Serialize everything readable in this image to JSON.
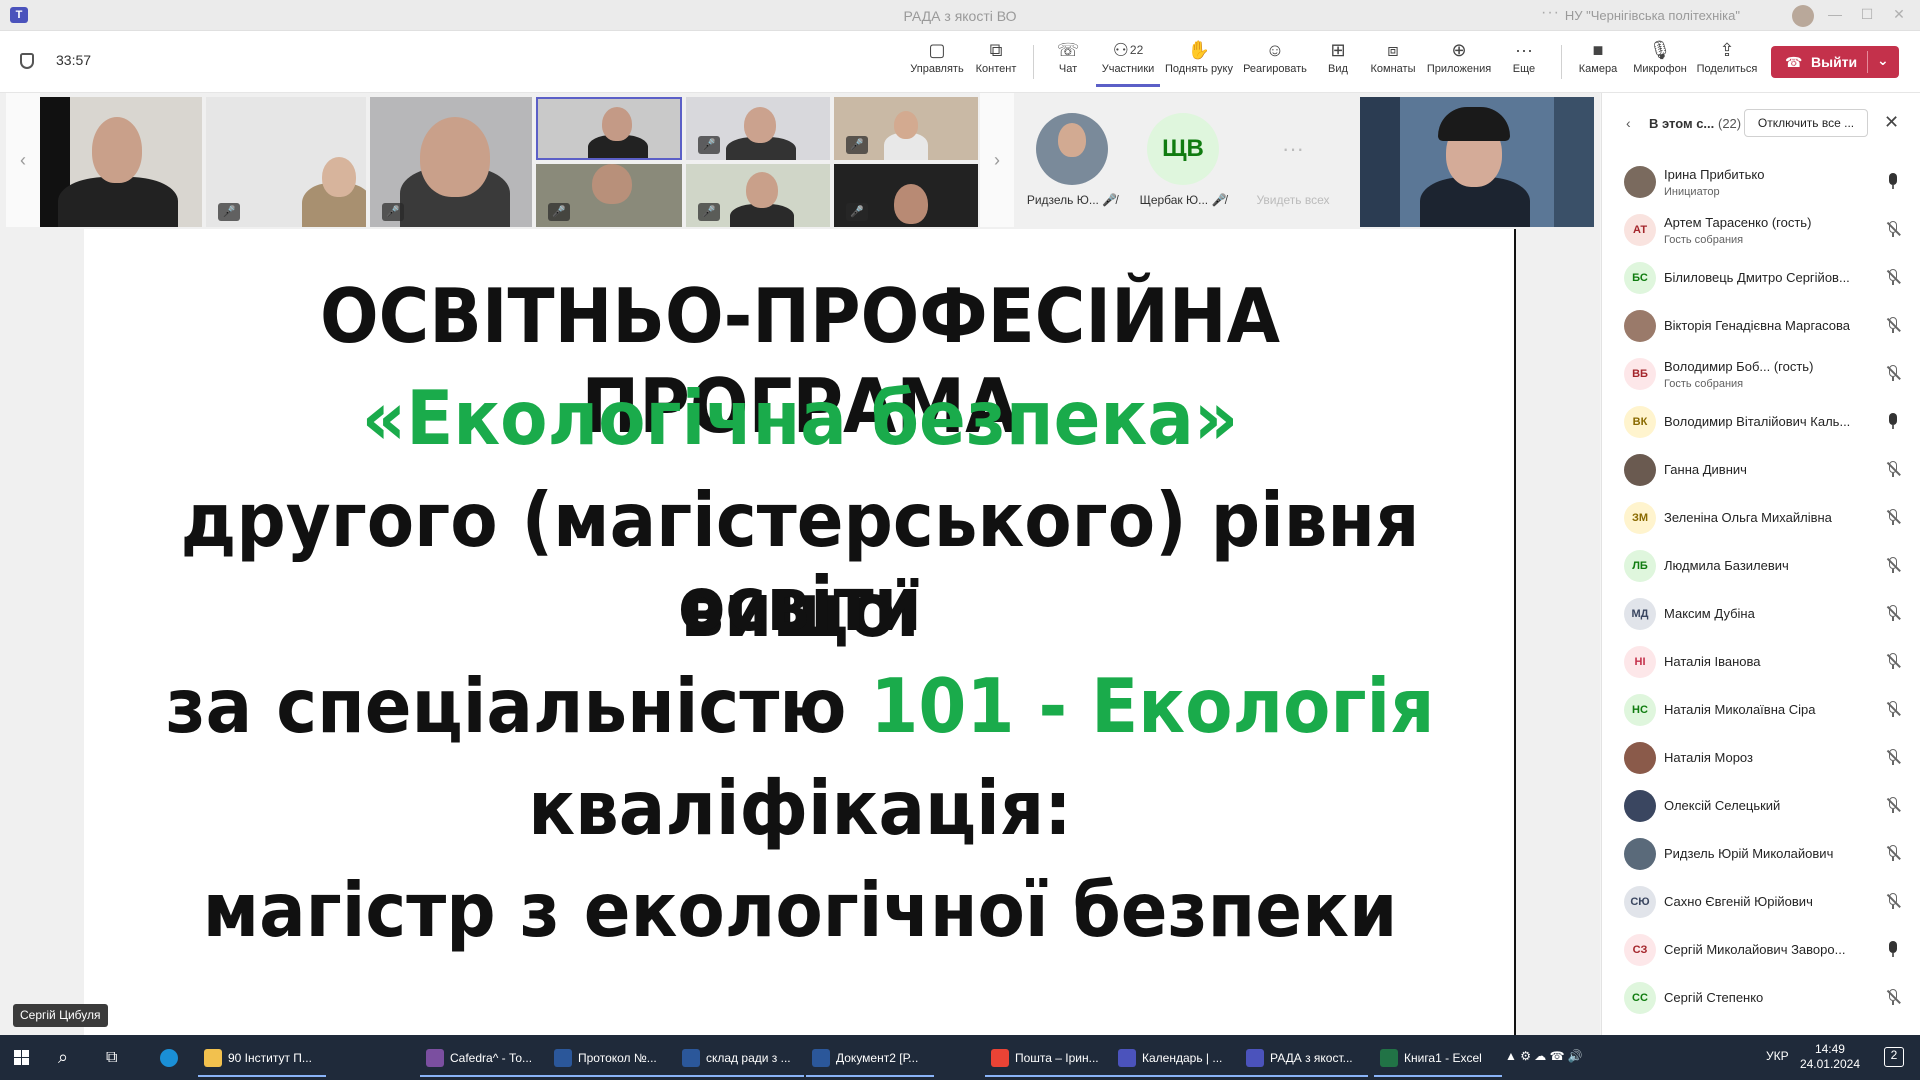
{
  "window": {
    "title": "РАДА з якості ВО",
    "org": "НУ \"Чернігівська політехніка\""
  },
  "meeting": {
    "timer": "33:57"
  },
  "toolbar": {
    "items": [
      {
        "label": "Управлять",
        "icon": "control-icon"
      },
      {
        "label": "Контент",
        "icon": "share-content-icon"
      },
      {
        "label": "Чат",
        "icon": "chat-icon"
      },
      {
        "label": "Участники",
        "icon": "people-icon",
        "badge": "22"
      },
      {
        "label": "Поднять руку",
        "icon": "hand-icon"
      },
      {
        "label": "Реагировать",
        "icon": "smile-icon"
      },
      {
        "label": "Вид",
        "icon": "view-icon"
      },
      {
        "label": "Комнаты",
        "icon": "rooms-icon"
      },
      {
        "label": "Приложения",
        "icon": "apps-icon"
      },
      {
        "label": "Еще",
        "icon": "more-icon"
      },
      {
        "label": "Камера",
        "icon": "camera-icon"
      },
      {
        "label": "Микрофон",
        "icon": "mic-icon"
      },
      {
        "label": "Поделиться",
        "icon": "share-icon"
      }
    ],
    "leave_label": "Выйти"
  },
  "gallery": {
    "avatars": [
      {
        "name": "Ридзель Ю...",
        "initials": ""
      },
      {
        "name": "Щербак Ю...",
        "initials": "ЩВ"
      },
      {
        "name": "Увидеть всех",
        "initials": "···"
      }
    ]
  },
  "slide": {
    "line1": "ОСВІТНЬО-ПРОФЕСІЙНА ПРОГРАМА",
    "line2": "«Екологічна безпека»",
    "line3": "другого (магістерського) рівня вищої",
    "line4": "освіти",
    "line5a": "за спеціальністю ",
    "line5b": "101 - Екологія",
    "line6": "кваліфікація:",
    "line7": "магістр з екологічної безпеки"
  },
  "speaker": "Сергій Цибуля",
  "panel": {
    "title": "В этом с...",
    "count": "(22)",
    "mute_all": "Отключить все ...",
    "participants": [
      {
        "name": "Ірина Прибитько",
        "sub": "Инициатор",
        "initials": "",
        "mic": "on",
        "bg": "#7a6a5e",
        "fg": "#fff"
      },
      {
        "name": "Артем Тарасенко (гость)",
        "sub": "Гость собрания",
        "initials": "АТ",
        "mic": "off",
        "bg": "#f9e3df",
        "fg": "#a4262c"
      },
      {
        "name": "Білиловець Дмитро Сергійов...",
        "sub": "",
        "initials": "БС",
        "mic": "off",
        "bg": "#dff6dd",
        "fg": "#107c10"
      },
      {
        "name": "Вікторія Генадієвна Маргасова",
        "sub": "",
        "initials": "",
        "mic": "off",
        "bg": "#9a7a6a",
        "fg": "#fff"
      },
      {
        "name": "Володимир Боб... (гость)",
        "sub": "Гость собрания",
        "initials": "ВБ",
        "mic": "off",
        "bg": "#fde7e9",
        "fg": "#a4262c"
      },
      {
        "name": "Володимир Віталійович Каль...",
        "sub": "",
        "initials": "ВК",
        "mic": "on",
        "bg": "#fff4ce",
        "fg": "#8a6a00"
      },
      {
        "name": "Ганна Дивнич",
        "sub": "",
        "initials": "",
        "mic": "off",
        "bg": "#6a5a50",
        "fg": "#fff"
      },
      {
        "name": "Зеленіна Ольга Михайлівна",
        "sub": "",
        "initials": "ЗМ",
        "mic": "off",
        "bg": "#fff4ce",
        "fg": "#8a6a00"
      },
      {
        "name": "Людмила Базилевич",
        "sub": "",
        "initials": "ЛБ",
        "mic": "off",
        "bg": "#dff6dd",
        "fg": "#107c10"
      },
      {
        "name": "Максим Дубіна",
        "sub": "",
        "initials": "МД",
        "mic": "off",
        "bg": "#e1e4ea",
        "fg": "#3a4660"
      },
      {
        "name": "Наталія Іванова",
        "sub": "",
        "initials": "НІ",
        "mic": "off",
        "bg": "#fde7e9",
        "fg": "#c4314b"
      },
      {
        "name": "Наталія Миколаївна Сіра",
        "sub": "",
        "initials": "НС",
        "mic": "off",
        "bg": "#dff6dd",
        "fg": "#107c10"
      },
      {
        "name": "Наталія Мороз",
        "sub": "",
        "initials": "",
        "mic": "off",
        "bg": "#8a5a4a",
        "fg": "#fff"
      },
      {
        "name": "Олексій Селецький",
        "sub": "",
        "initials": "",
        "mic": "off",
        "bg": "#3a4660",
        "fg": "#fff"
      },
      {
        "name": "Ридзель Юрій Миколайович",
        "sub": "",
        "initials": "",
        "mic": "off",
        "bg": "#5a6a7a",
        "fg": "#fff"
      },
      {
        "name": "Сахно Євгеній Юрійович",
        "sub": "",
        "initials": "СЮ",
        "mic": "off",
        "bg": "#e1e4ea",
        "fg": "#3a4660"
      },
      {
        "name": "Сергій Миколайович Заворо...",
        "sub": "",
        "initials": "СЗ",
        "mic": "on",
        "bg": "#fde7e9",
        "fg": "#a4262c"
      },
      {
        "name": "Сергій Степенко",
        "sub": "",
        "initials": "СС",
        "mic": "off",
        "bg": "#dff6dd",
        "fg": "#107c10"
      }
    ]
  },
  "taskbar": {
    "apps": [
      {
        "label": "90 Інститут П...",
        "color": "#f2c14e"
      },
      {
        "label": "Cafedra^ - То...",
        "color": "#7b4fa0"
      },
      {
        "label": "Протокол №...",
        "color": "#2b579a"
      },
      {
        "label": "склад ради з ...",
        "color": "#2b579a"
      },
      {
        "label": "Документ2 [Р...",
        "color": "#2b579a"
      },
      {
        "label": "Пошта – Ірин...",
        "color": "#ea4335"
      },
      {
        "label": "Календарь | ...",
        "color": "#4b53bc"
      },
      {
        "label": "РАДА з якост...",
        "color": "#4b53bc"
      },
      {
        "label": "Книга1 - Excel",
        "color": "#217346"
      }
    ],
    "lang": "УКР",
    "time": "14:49",
    "date": "24.01.2024",
    "notif": "2"
  }
}
